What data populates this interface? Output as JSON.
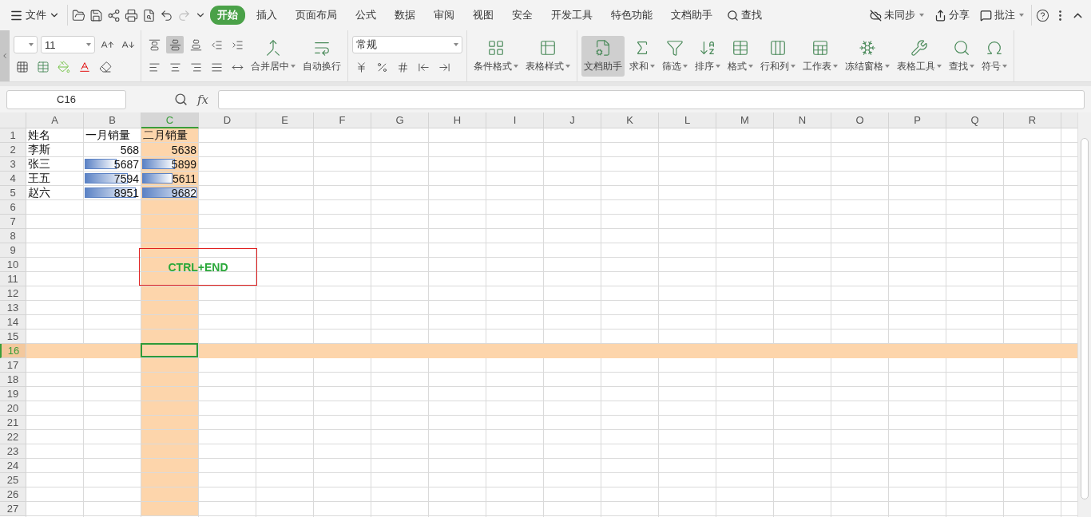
{
  "menu": {
    "file": "文件"
  },
  "tabs": [
    {
      "label": "开始",
      "selected": true
    },
    {
      "label": "插入",
      "selected": false
    },
    {
      "label": "页面布局",
      "selected": false
    },
    {
      "label": "公式",
      "selected": false
    },
    {
      "label": "数据",
      "selected": false
    },
    {
      "label": "审阅",
      "selected": false
    },
    {
      "label": "视图",
      "selected": false
    },
    {
      "label": "安全",
      "selected": false
    },
    {
      "label": "开发工具",
      "selected": false
    },
    {
      "label": "特色功能",
      "selected": false
    },
    {
      "label": "文档助手",
      "selected": false
    }
  ],
  "search_tab": "查找",
  "right_actions": [
    {
      "label": "未同步",
      "caret": true
    },
    {
      "label": "分享",
      "caret": false
    },
    {
      "label": "批注",
      "caret": true
    }
  ],
  "ribbon": {
    "font_size": "11",
    "number_format": "常规",
    "align_buttons": [
      {
        "label": "合并居中",
        "caret": true
      },
      {
        "label": "自动换行",
        "caret": false
      }
    ],
    "style_buttons": [
      {
        "label": "条件格式",
        "caret": true
      },
      {
        "label": "表格样式",
        "caret": true
      }
    ],
    "tool_buttons": [
      {
        "label": "文档助手",
        "caret": false,
        "selected": true
      },
      {
        "label": "求和",
        "caret": true,
        "selected": false
      },
      {
        "label": "筛选",
        "caret": true,
        "selected": false
      },
      {
        "label": "排序",
        "caret": true,
        "selected": false
      },
      {
        "label": "格式",
        "caret": true,
        "selected": false
      },
      {
        "label": "行和列",
        "caret": true,
        "selected": false
      },
      {
        "label": "工作表",
        "caret": true,
        "selected": false
      },
      {
        "label": "冻结窗格",
        "caret": true,
        "selected": false
      },
      {
        "label": "表格工具",
        "caret": true,
        "selected": false
      },
      {
        "label": "查找",
        "caret": true,
        "selected": false
      },
      {
        "label": "符号",
        "caret": true,
        "selected": false
      }
    ]
  },
  "formula_bar": {
    "name_box": "C16",
    "fx_label": "fx"
  },
  "columns": [
    {
      "label": "A",
      "selected": false
    },
    {
      "label": "B",
      "selected": false
    },
    {
      "label": "C",
      "selected": true
    },
    {
      "label": "D",
      "selected": false
    },
    {
      "label": "E",
      "selected": false
    },
    {
      "label": "F",
      "selected": false
    },
    {
      "label": "G",
      "selected": false
    },
    {
      "label": "H",
      "selected": false
    },
    {
      "label": "I",
      "selected": false
    },
    {
      "label": "J",
      "selected": false
    },
    {
      "label": "K",
      "selected": false
    },
    {
      "label": "L",
      "selected": false
    },
    {
      "label": "M",
      "selected": false
    },
    {
      "label": "N",
      "selected": false
    },
    {
      "label": "O",
      "selected": false
    },
    {
      "label": "P",
      "selected": false
    },
    {
      "label": "Q",
      "selected": false
    },
    {
      "label": "R",
      "selected": false
    }
  ],
  "rows": [
    {
      "label": "1",
      "selected": false,
      "cells": [
        {
          "text": "姓名",
          "kind": "text"
        },
        {
          "text": "一月销量",
          "kind": "text"
        },
        {
          "text": "二月销量",
          "kind": "text"
        }
      ]
    },
    {
      "label": "2",
      "selected": false,
      "cells": [
        {
          "text": "李斯",
          "kind": "text"
        },
        {
          "text": "568",
          "kind": "number"
        },
        {
          "text": "5638",
          "kind": "number"
        }
      ]
    },
    {
      "label": "3",
      "selected": false,
      "cells": [
        {
          "text": "张三",
          "kind": "text"
        },
        {
          "text": "5687",
          "kind": "number",
          "level": 0.59
        },
        {
          "text": "5899",
          "kind": "number",
          "level": 0.6
        }
      ]
    },
    {
      "label": "4",
      "selected": false,
      "cells": [
        {
          "text": "王五",
          "kind": "text"
        },
        {
          "text": "7594",
          "kind": "number",
          "level": 0.79
        },
        {
          "text": "5611",
          "kind": "number",
          "level": 0.57
        }
      ]
    },
    {
      "label": "5",
      "selected": false,
      "cells": [
        {
          "text": "赵六",
          "kind": "text"
        },
        {
          "text": "8951",
          "kind": "number",
          "level": 0.93
        },
        {
          "text": "9682",
          "kind": "number",
          "level": 1
        }
      ]
    },
    {
      "label": "6",
      "selected": false
    },
    {
      "label": "7",
      "selected": false
    },
    {
      "label": "8",
      "selected": false
    },
    {
      "label": "9",
      "selected": false
    },
    {
      "label": "10",
      "selected": false
    },
    {
      "label": "11",
      "selected": false
    },
    {
      "label": "12",
      "selected": false
    },
    {
      "label": "13",
      "selected": false
    },
    {
      "label": "14",
      "selected": false
    },
    {
      "label": "15",
      "selected": false
    },
    {
      "label": "16",
      "selected": true
    },
    {
      "label": "17",
      "selected": false
    },
    {
      "label": "18",
      "selected": false
    },
    {
      "label": "19",
      "selected": false
    },
    {
      "label": "20",
      "selected": false
    },
    {
      "label": "21",
      "selected": false
    },
    {
      "label": "22",
      "selected": false
    },
    {
      "label": "23",
      "selected": false
    },
    {
      "label": "24",
      "selected": false
    },
    {
      "label": "25",
      "selected": false
    },
    {
      "label": "26",
      "selected": false
    },
    {
      "label": "27",
      "selected": false
    }
  ],
  "annotation": {
    "text": "CTRL+END"
  }
}
